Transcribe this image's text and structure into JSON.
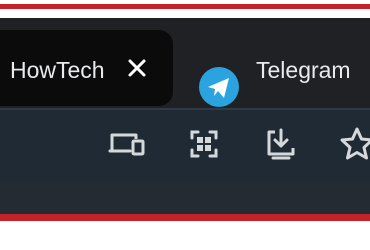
{
  "tabs": {
    "active": {
      "title": "HowTech",
      "close_label": "✕"
    },
    "inactive": {
      "title": "Telegram",
      "icon": "telegram-icon"
    }
  },
  "toolbar": {
    "icons": [
      "cast-icon",
      "apps-grid-icon",
      "install-app-icon",
      "star-icon"
    ]
  },
  "colors": {
    "frame_red": "#c4212a",
    "tab_strip": "#202124",
    "active_tab": "#0b0b0c",
    "toolbar": "#202a34",
    "telegram_blue": "#2aa3df",
    "text": "#e8eaed"
  }
}
